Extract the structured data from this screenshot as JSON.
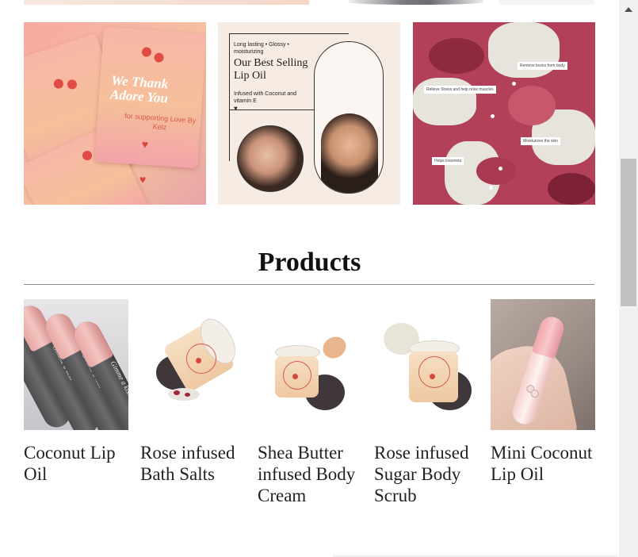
{
  "gallery": {
    "tile1": {
      "card_text": "We Thank Adore You",
      "card_sub": "for supporting Love By Kelz"
    },
    "tile2": {
      "tagline": "Long lasting • Glossy • moisturizing",
      "title": "Our Best Selling Lip Oil",
      "description": "Infused with Coconut and vitamin E",
      "heart": "♥"
    },
    "tile3": {
      "callouts": [
        "Remove toxins from body",
        "Relieve Stress and help relax muscles",
        "Moisturizes the skin",
        "Helps insomnia"
      ]
    }
  },
  "products": {
    "heading": "Products",
    "items": [
      {
        "name": "Coconut Lip Oil",
        "tube_text": "Gimme a kiss"
      },
      {
        "name": "Rose infused Bath Salts"
      },
      {
        "name": "Shea Butter infused Body Cream"
      },
      {
        "name": "Rose infused Sugar Body Scrub"
      },
      {
        "name": "Mini Coconut Lip Oil"
      }
    ]
  },
  "icons": {
    "scroll_up": "triangle-up-icon"
  },
  "colors": {
    "accent_pink": "#f4b3a8",
    "heading": "#111111",
    "product_text": "#222222",
    "rule": "#8b8b8b"
  }
}
